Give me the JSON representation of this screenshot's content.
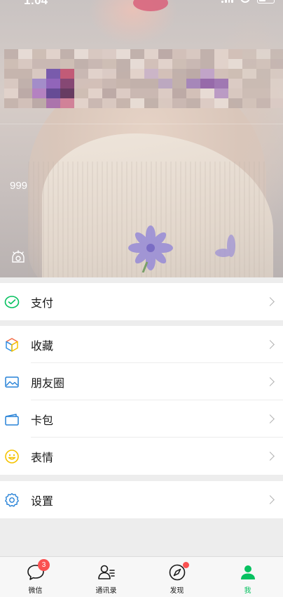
{
  "status_bar": {
    "time": "1:04"
  },
  "profile": {
    "count_text": "999"
  },
  "menu": {
    "pay": {
      "label": "支付",
      "icon": "wallet-check-icon",
      "color": "#07c160"
    },
    "favorites": {
      "label": "收藏",
      "icon": "cube-icon"
    },
    "moments": {
      "label": "朋友圈",
      "icon": "photo-icon",
      "color": "#2782d7"
    },
    "cards": {
      "label": "卡包",
      "icon": "card-wallet-icon",
      "color": "#2782d7"
    },
    "stickers": {
      "label": "表情",
      "icon": "smiley-icon",
      "color": "#f5c300"
    },
    "settings": {
      "label": "设置",
      "icon": "gear-icon",
      "color": "#2782d7"
    }
  },
  "tabbar": {
    "tabs": [
      {
        "label": "微信",
        "icon": "chat-bubble-icon",
        "badge": "3"
      },
      {
        "label": "通讯录",
        "icon": "contacts-icon"
      },
      {
        "label": "发现",
        "icon": "compass-icon"
      },
      {
        "label": "我",
        "icon": "person-icon",
        "active": true
      }
    ],
    "active_color": "#07c160",
    "badge_color": "#fa5151"
  }
}
